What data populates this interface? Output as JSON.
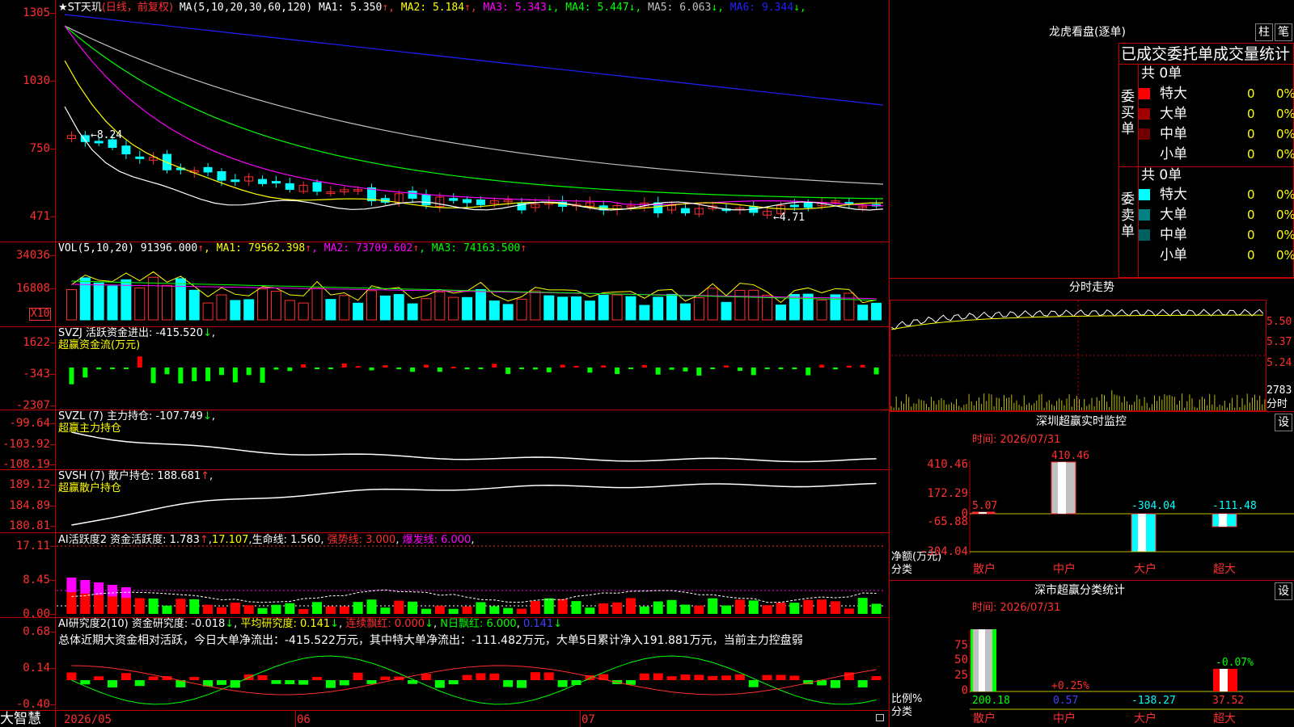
{
  "main": {
    "header": {
      "stock": "★ST天玑",
      "period": "(日线，前复权)",
      "ma_def": "MA(5,10,20,30,60,120)",
      "ma": [
        {
          "label": "MA1:",
          "val": "5.350",
          "arrow": "↑",
          "color": "#ffffff"
        },
        {
          "label": "MA2:",
          "val": "5.184",
          "arrow": "↑",
          "color": "#ffff00"
        },
        {
          "label": "MA3:",
          "val": "5.343",
          "arrow": "↓",
          "color": "#ff00ff"
        },
        {
          "label": "MA4:",
          "val": "5.447",
          "arrow": "↓",
          "color": "#00ff00"
        },
        {
          "label": "MA5:",
          "val": "6.063",
          "arrow": "↓",
          "color": "#c0c0c0"
        },
        {
          "label": "MA6:",
          "val": "9.344",
          "arrow": "↓",
          "color": "#2020ff"
        }
      ]
    },
    "price_axis": [
      "1305",
      "1030",
      "750",
      "471"
    ],
    "high_label": "8.24",
    "low_label": "4.71",
    "vol": {
      "header": "VOL(5,10,20)",
      "value": "91396.000",
      "ma": [
        {
          "label": "MA1:",
          "val": "79562.398",
          "arrow": "↑",
          "color": "#ffff00"
        },
        {
          "label": "MA2:",
          "val": "73709.602",
          "arrow": "↑",
          "color": "#ff00ff"
        },
        {
          "label": "MA3:",
          "val": "74163.500",
          "arrow": "↑",
          "color": "#00ff00"
        }
      ],
      "axis": [
        "34036",
        "16808"
      ],
      "unit": "X10"
    },
    "svzj": {
      "header": "SVZJ  活跃资金进出:",
      "value": "-415.520",
      "arrow": "↓",
      "title": "超赢资金流(万元)",
      "axis": [
        "1622",
        "-343",
        "-2307"
      ]
    },
    "svzl": {
      "header": "SVZL (7) 主力持仓:",
      "value": "-107.749",
      "arrow": "↓",
      "title": "超赢主力持仓",
      "axis": [
        "-99.64",
        "-103.92",
        "-108.19"
      ]
    },
    "svsh": {
      "header": "SVSH (7) 散户持仓:",
      "value": "188.681",
      "arrow": "↑",
      "title": "超赢散户持仓",
      "axis": [
        "189.12",
        "184.89",
        "180.81"
      ]
    },
    "ai1": {
      "header": "AI活跃度2 资金活跃度:",
      "v1": "1.783",
      "a1": "↑",
      "v2": "17.107",
      "v3label": "生命线:",
      "v3": "1.560",
      "strong": "强势线: 3.000",
      "burst": "爆发线: 6.000",
      "axis": [
        "17.11",
        "8.45",
        "0.00"
      ]
    },
    "ai2": {
      "header": "AI研究度2(10) 资金研究度:",
      "v1": "-0.018",
      "a1": "↓",
      "avg": "平均研究度: 0.141",
      "a2": "↓",
      "red": "连续飘红: 0.000",
      "a3": "↓",
      "nred": "N日飘红: 6.000",
      "last": "0.141",
      "a4": "↓",
      "summary": "总体近期大资金相对活跃，今日大单净流出：-415.522万元，其中特大单净流出：-111.482万元，大单5日累计净入191.881万元，当前主力控盘弱",
      "axis": [
        "0.68",
        "0.14",
        "-0.40"
      ]
    },
    "dates": [
      "2026/05",
      "06",
      "07"
    ],
    "brand": "大智慧"
  },
  "right": {
    "lhb": {
      "title": "龙虎看盘(逐单)",
      "btn1": "柱",
      "btn2": "笔",
      "subtitle": "已成交委托单成交量统计",
      "buy_label": "委买单",
      "sell_label": "委卖单",
      "buy_total": "共 0单",
      "sell_total": "共 0单",
      "buy_rows": [
        {
          "name": "特大",
          "count": "0",
          "pct": "0%",
          "color": "#ff0000"
        },
        {
          "name": "大单",
          "count": "0",
          "pct": "0%",
          "color": "#a00000"
        },
        {
          "name": "中单",
          "count": "0",
          "pct": "0%",
          "color": "#700000"
        },
        {
          "name": "小单",
          "count": "0",
          "pct": "0%",
          "color": ""
        }
      ],
      "sell_rows": [
        {
          "name": "特大",
          "count": "0",
          "pct": "0%",
          "color": "#00ffff"
        },
        {
          "name": "大单",
          "count": "0",
          "pct": "0%",
          "color": "#008080"
        },
        {
          "name": "中单",
          "count": "0",
          "pct": "0%",
          "color": "#006060"
        },
        {
          "name": "小单",
          "count": "0",
          "pct": "0%",
          "color": ""
        }
      ]
    },
    "intraday": {
      "title": "分时走势",
      "axis": [
        "5.50",
        "5.37",
        "5.24"
      ],
      "vol_axis": "2783",
      "vol_unit": "分时"
    },
    "monitor": {
      "title": "深圳超赢实时监控",
      "btn": "设",
      "time": "时间: 2026/07/31",
      "axis": [
        "410.46",
        "172.29",
        "0",
        "-65.88",
        "-304.04"
      ],
      "unit": "净额(万元)",
      "unit2": "分类",
      "categories": [
        "散户",
        "中户",
        "大户",
        "超大"
      ],
      "values": [
        "5.07",
        "410.46",
        "-304.04",
        "-111.48"
      ]
    },
    "classify": {
      "title": "深市超赢分类统计",
      "btn": "设",
      "time": "时间: 2026/07/31",
      "axis": [
        "75",
        "50",
        "25",
        "0"
      ],
      "unit": "比例%",
      "unit2": "分类",
      "categories": [
        "散户",
        "中户",
        "大户",
        "超大"
      ],
      "values": [
        "200.18",
        "0.57",
        "-138.27",
        "37.52"
      ],
      "pct_labels": [
        "+0.25%",
        "-0.07%"
      ]
    }
  }
}
